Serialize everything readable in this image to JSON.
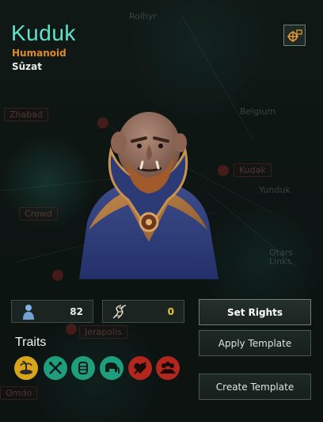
{
  "species": {
    "name": "Kuduk",
    "class": "Humanoid",
    "homeworld": "Sûzat"
  },
  "stats": {
    "population": "82",
    "modifications": "0"
  },
  "traits": {
    "title": "Traits",
    "items": [
      {
        "icon": "island-icon",
        "color": "#d7a51c"
      },
      {
        "icon": "tools-icon",
        "color": "#1f9e7e"
      },
      {
        "icon": "cylinder-icon",
        "color": "#1f9e7e"
      },
      {
        "icon": "elephant-icon",
        "color": "#1f9e7e"
      },
      {
        "icon": "heart-crossed-icon",
        "color": "#b3261e"
      },
      {
        "icon": "crowd-icon",
        "color": "#b3261e"
      }
    ]
  },
  "buttons": {
    "set_rights": "Set Rights",
    "apply_template": "Apply Template",
    "create_template": "Create Template"
  },
  "map": {
    "labels": [
      "Roihyr",
      "Belgium",
      "Yunduk",
      "Otars Links",
      "Kudak",
      "Jerapolis",
      "Zhabad",
      "Crowd",
      "Omdo"
    ]
  },
  "colors": {
    "name": "#5fe4c9",
    "class": "#e08a2c",
    "population_value": "#e8ecea",
    "modifications_value": "#e8c53a"
  }
}
